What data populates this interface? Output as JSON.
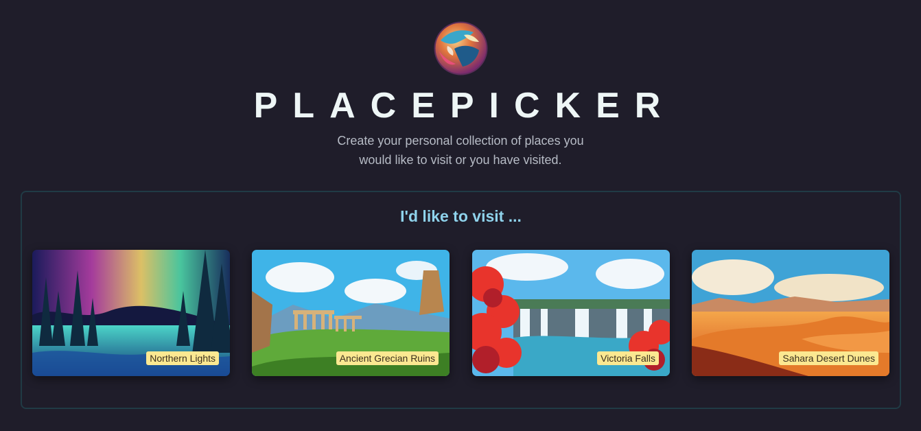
{
  "app": {
    "title": "PLACEPICKER",
    "tagline": [
      "Create your personal collection of places you",
      "would like to visit or you have visited."
    ],
    "logo_icon": "globe-icon"
  },
  "section": {
    "heading": "I'd like to visit ..."
  },
  "places": [
    {
      "title": "Northern Lights"
    },
    {
      "title": "Ancient Grecian Ruins"
    },
    {
      "title": "Victoria Falls"
    },
    {
      "title": "Sahara Desert Dunes"
    }
  ],
  "colors": {
    "background": "#1f1d2a",
    "title": "#eef6f6",
    "heading": "#8fd3ec",
    "caption_bg": "#fbe891",
    "section_border": "#203b45"
  }
}
